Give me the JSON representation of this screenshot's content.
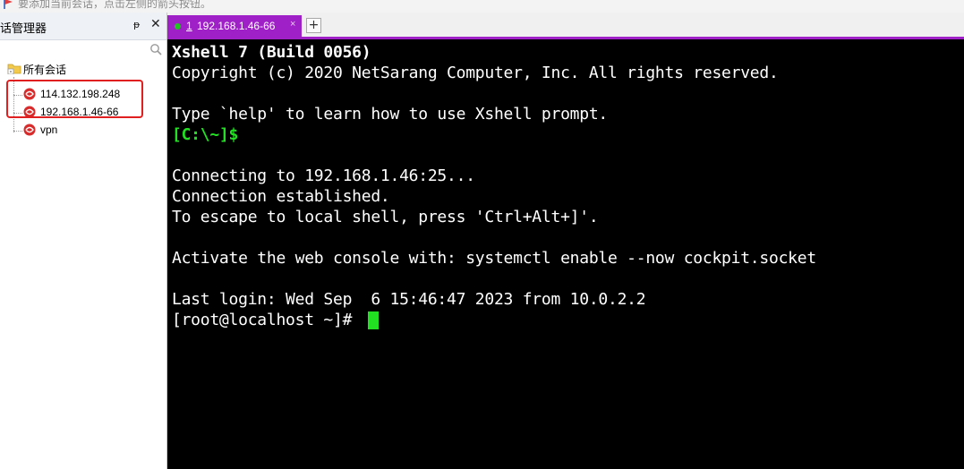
{
  "hint": {
    "text": "要添加当前会话，点击左侧的箭头按钮。",
    "icon": "flag-icon"
  },
  "panel": {
    "title": "话管理器",
    "pin": "ᵽ",
    "close": "✕",
    "search_icon": "search-icon",
    "tree": {
      "folder": "所有会话",
      "sessions": [
        "114.132.198.248",
        "192.168.1.46-66",
        "vpn"
      ]
    }
  },
  "tabs": {
    "active": {
      "number": "1",
      "title": "192.168.1.46-66",
      "close": "×",
      "status_color": "#23c423"
    },
    "add": "+"
  },
  "terminal": {
    "lines": [
      "Xshell 7 (Build 0056)",
      "Copyright (c) 2020 NetSarang Computer, Inc. All rights reserved.",
      "",
      "Type `help' to learn how to use Xshell prompt.",
      "[C:\\~]$",
      "",
      "Connecting to 192.168.1.46:25...",
      "Connection established.",
      "To escape to local shell, press 'Ctrl+Alt+]'.",
      "",
      "Activate the web console with: systemctl enable --now cockpit.socket",
      "",
      "Last login: Wed Sep  6 15:46:47 2023 from 10.0.2.2",
      "[root@localhost ~]# "
    ]
  },
  "colors": {
    "accent": "#a020c8",
    "terminal_bg": "#000000",
    "terminal_fg": "#ffffff",
    "prompt_green": "#22e022",
    "highlight": "#e02020"
  }
}
